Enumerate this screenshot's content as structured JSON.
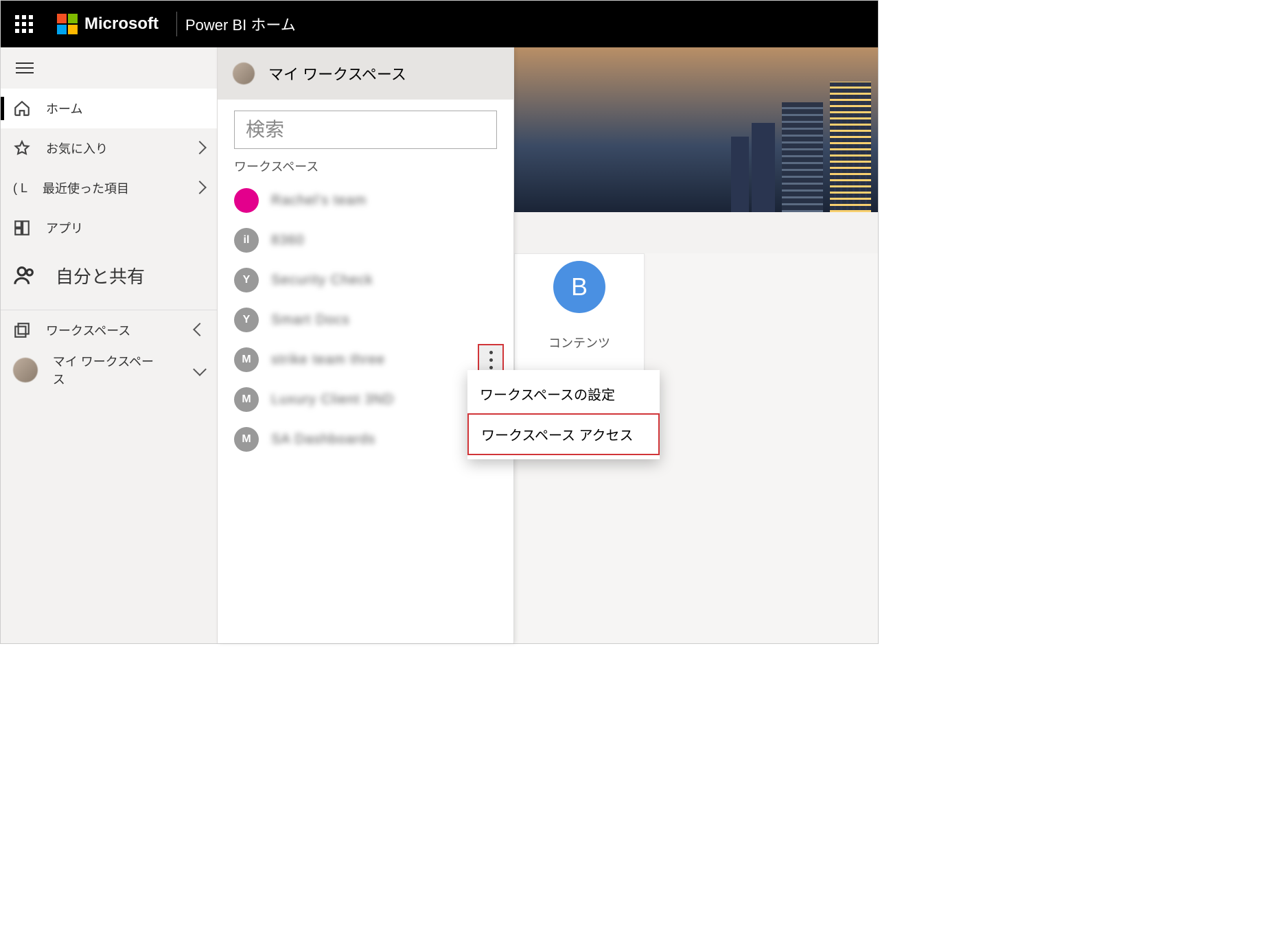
{
  "header": {
    "brand": "Microsoft",
    "app_title": "Power BI ホーム"
  },
  "nav": {
    "home": "ホーム",
    "favorites": "お気に入り",
    "recent": "最近使った項目",
    "apps": "アプリ",
    "shared": "自分と共有",
    "workspaces": "ワークスペース",
    "my_workspace": "マイ ワークスペース"
  },
  "flyout": {
    "title": "マイ ワークスペース",
    "search_placeholder": "検索",
    "section_label": "ワークスペース",
    "items": [
      {
        "label": "Rachel's team",
        "icon_letter": "",
        "color": "pink"
      },
      {
        "label": "8360",
        "icon_letter": "il",
        "color": ""
      },
      {
        "label": "Security Check",
        "icon_letter": "Y",
        "color": ""
      },
      {
        "label": "Smart Docs",
        "icon_letter": "Y",
        "color": ""
      },
      {
        "label": "strike team three",
        "icon_letter": "M",
        "color": "",
        "more": true
      },
      {
        "label": "Luxury Client 3ND",
        "icon_letter": "M",
        "color": ""
      },
      {
        "label": "SA Dashboards",
        "icon_letter": "M",
        "color": ""
      }
    ]
  },
  "tile": {
    "badge_letter": "B",
    "caption_fragment": "コンテンツ"
  },
  "context_menu": {
    "settings": "ワークスペースの設定",
    "access": "ワークスペース アクセス"
  }
}
